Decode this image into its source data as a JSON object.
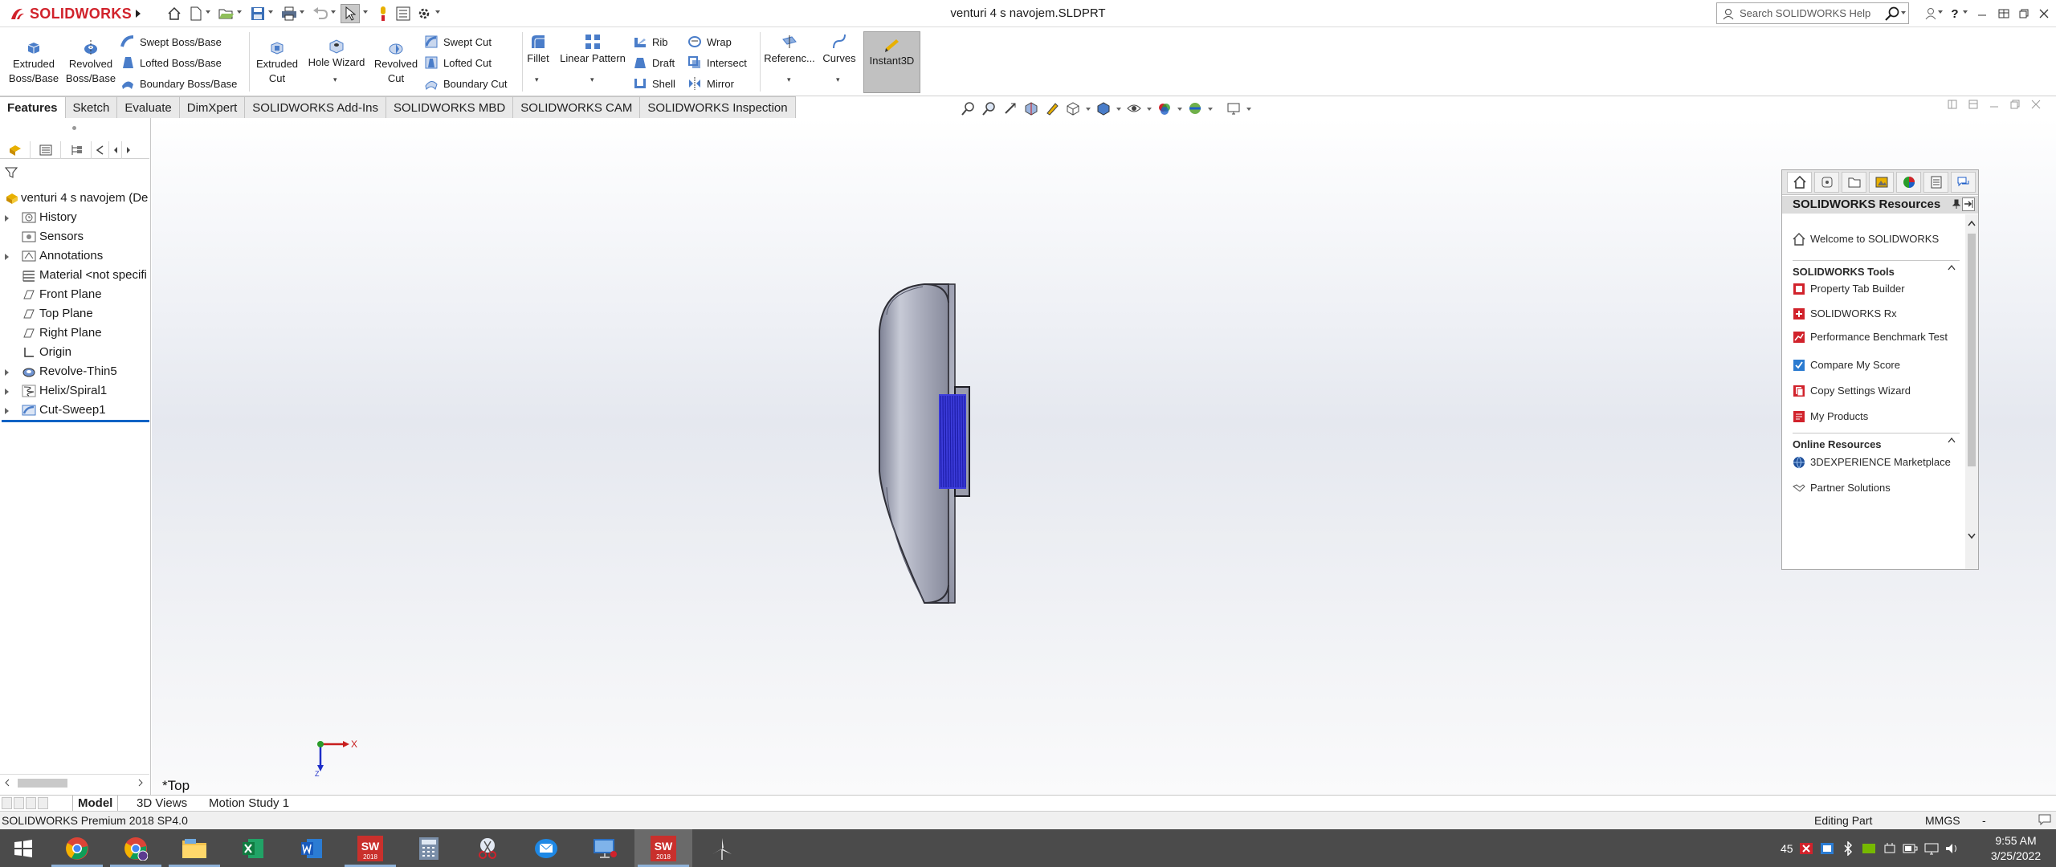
{
  "app": {
    "brand_ds": "3DS",
    "brand_name": "SOLIDWORKS",
    "document_title": "venturi 4 s navojem.SLDPRT"
  },
  "help_search": {
    "placeholder": "Search SOLIDWORKS Help"
  },
  "commands": {
    "extruded_boss": "Extruded Boss/Base",
    "revolved_boss": "Revolved Boss/Base",
    "swept_boss": "Swept Boss/Base",
    "lofted_boss": "Lofted Boss/Base",
    "boundary_boss": "Boundary Boss/Base",
    "extruded_cut": "Extruded Cut",
    "hole_wizard": "Hole Wizard",
    "revolved_cut": "Revolved Cut",
    "swept_cut": "Swept Cut",
    "lofted_cut": "Lofted Cut",
    "boundary_cut": "Boundary Cut",
    "fillet": "Fillet",
    "linear_pattern": "Linear Pattern",
    "rib": "Rib",
    "draft": "Draft",
    "shell": "Shell",
    "wrap": "Wrap",
    "intersect": "Intersect",
    "mirror": "Mirror",
    "reference": "Referenc...",
    "curves": "Curves",
    "instant3d": "Instant3D"
  },
  "tabs": [
    "Features",
    "Sketch",
    "Evaluate",
    "DimXpert",
    "SOLIDWORKS Add-Ins",
    "SOLIDWORKS MBD",
    "SOLIDWORKS CAM",
    "SOLIDWORKS Inspection"
  ],
  "tree": {
    "root": "venturi 4 s navojem  (De",
    "items": [
      {
        "label": "History",
        "expandable": true
      },
      {
        "label": "Sensors",
        "expandable": false
      },
      {
        "label": "Annotations",
        "expandable": true
      },
      {
        "label": "Material <not specifi",
        "expandable": false
      },
      {
        "label": "Front Plane",
        "expandable": false
      },
      {
        "label": "Top Plane",
        "expandable": false
      },
      {
        "label": "Right Plane",
        "expandable": false
      },
      {
        "label": "Origin",
        "expandable": false
      },
      {
        "label": "Revolve-Thin5",
        "expandable": true
      },
      {
        "label": "Helix/Spiral1",
        "expandable": true
      },
      {
        "label": "Cut-Sweep1",
        "expandable": true
      }
    ]
  },
  "viewport": {
    "view_name": "*Top",
    "triad_x": "X",
    "triad_y": "Z"
  },
  "task_pane": {
    "title": "SOLIDWORKS Resources",
    "welcome": "Welcome to SOLIDWORKS",
    "tools_header": "SOLIDWORKS Tools",
    "tools": [
      "Property Tab Builder",
      "SOLIDWORKS Rx",
      "Performance Benchmark Test",
      "Compare My Score",
      "Copy Settings Wizard",
      "My Products"
    ],
    "online_header": "Online Resources",
    "online": [
      "3DEXPERIENCE Marketplace",
      "Partner Solutions"
    ]
  },
  "bottom_tabs": [
    "Model",
    "3D Views",
    "Motion Study 1"
  ],
  "status": {
    "left": "SOLIDWORKS Premium 2018 SP4.0",
    "mode": "Editing Part",
    "units": "MMGS",
    "units_caret": "-"
  },
  "taskbar": {
    "notify_count": "45",
    "time": "9:55 AM",
    "date": "3/25/2022",
    "sw_year": "2018"
  },
  "colors": {
    "brand_red": "#d1222b",
    "thread_blue": "#3d3ddb",
    "part_gray": "#9fa2b3",
    "selection_blue": "#0b63c5"
  }
}
